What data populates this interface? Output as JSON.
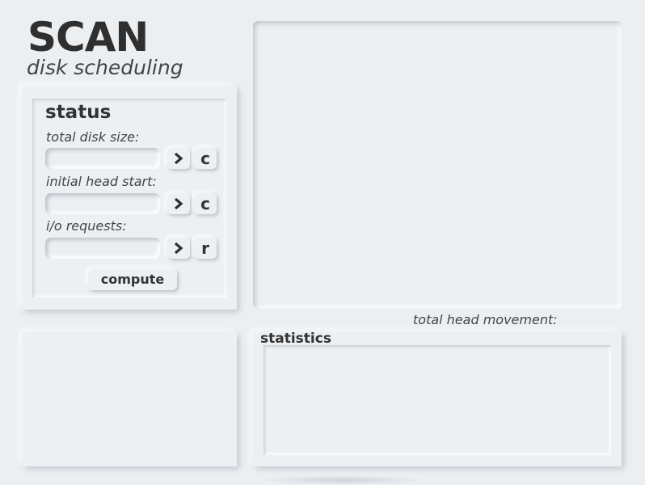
{
  "header": {
    "title": "SCAN",
    "subtitle": "disk scheduling"
  },
  "status": {
    "heading": "status",
    "fields": [
      {
        "label": "total disk size:",
        "value": "",
        "arrow_icon": "chevron-right-icon",
        "action_label": "c"
      },
      {
        "label": "initial head start:",
        "value": "",
        "arrow_icon": "chevron-right-icon",
        "action_label": "c"
      },
      {
        "label": "i/o requests:",
        "value": "",
        "arrow_icon": "chevron-right-icon",
        "action_label": "r"
      }
    ],
    "compute_label": "compute"
  },
  "visualization": {
    "total_head_movement_label": "total head movement:"
  },
  "statistics": {
    "heading": "statistics"
  }
}
